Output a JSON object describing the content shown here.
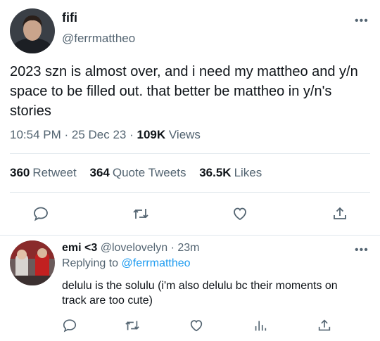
{
  "tweet": {
    "display_name": "fifi",
    "handle": "@ferrmattheo",
    "text": "2023 szn is almost over, and i need my mattheo and y/n space to be filled out. that better be mattheo in y/n's stories",
    "time": "10:54 PM",
    "date": "25 Dec 23",
    "views_count": "109K",
    "views_label": "Views",
    "retweets_count": "360",
    "retweets_label": "Retweet",
    "quotes_count": "364",
    "quotes_label": "Quote Tweets",
    "likes_count": "36.5K",
    "likes_label": "Likes",
    "actions": [
      "reply-icon",
      "retweet-icon",
      "like-icon",
      "share-icon"
    ]
  },
  "reply": {
    "display_name": "emi <3",
    "handle": "@lovelovelyn",
    "age": "23m",
    "replying_to_label": "Replying to",
    "replying_to_handle": "@ferrmattheo",
    "text": "delulu is the solulu (i'm also delulu bc their moments on track are too cute)",
    "actions": [
      "reply-icon",
      "retweet-icon",
      "like-icon",
      "analytics-icon",
      "share-icon"
    ]
  },
  "colors": {
    "text_primary": "#0f1419",
    "text_secondary": "#536471",
    "link": "#1d9bf0",
    "divider": "#e1e8ed"
  }
}
